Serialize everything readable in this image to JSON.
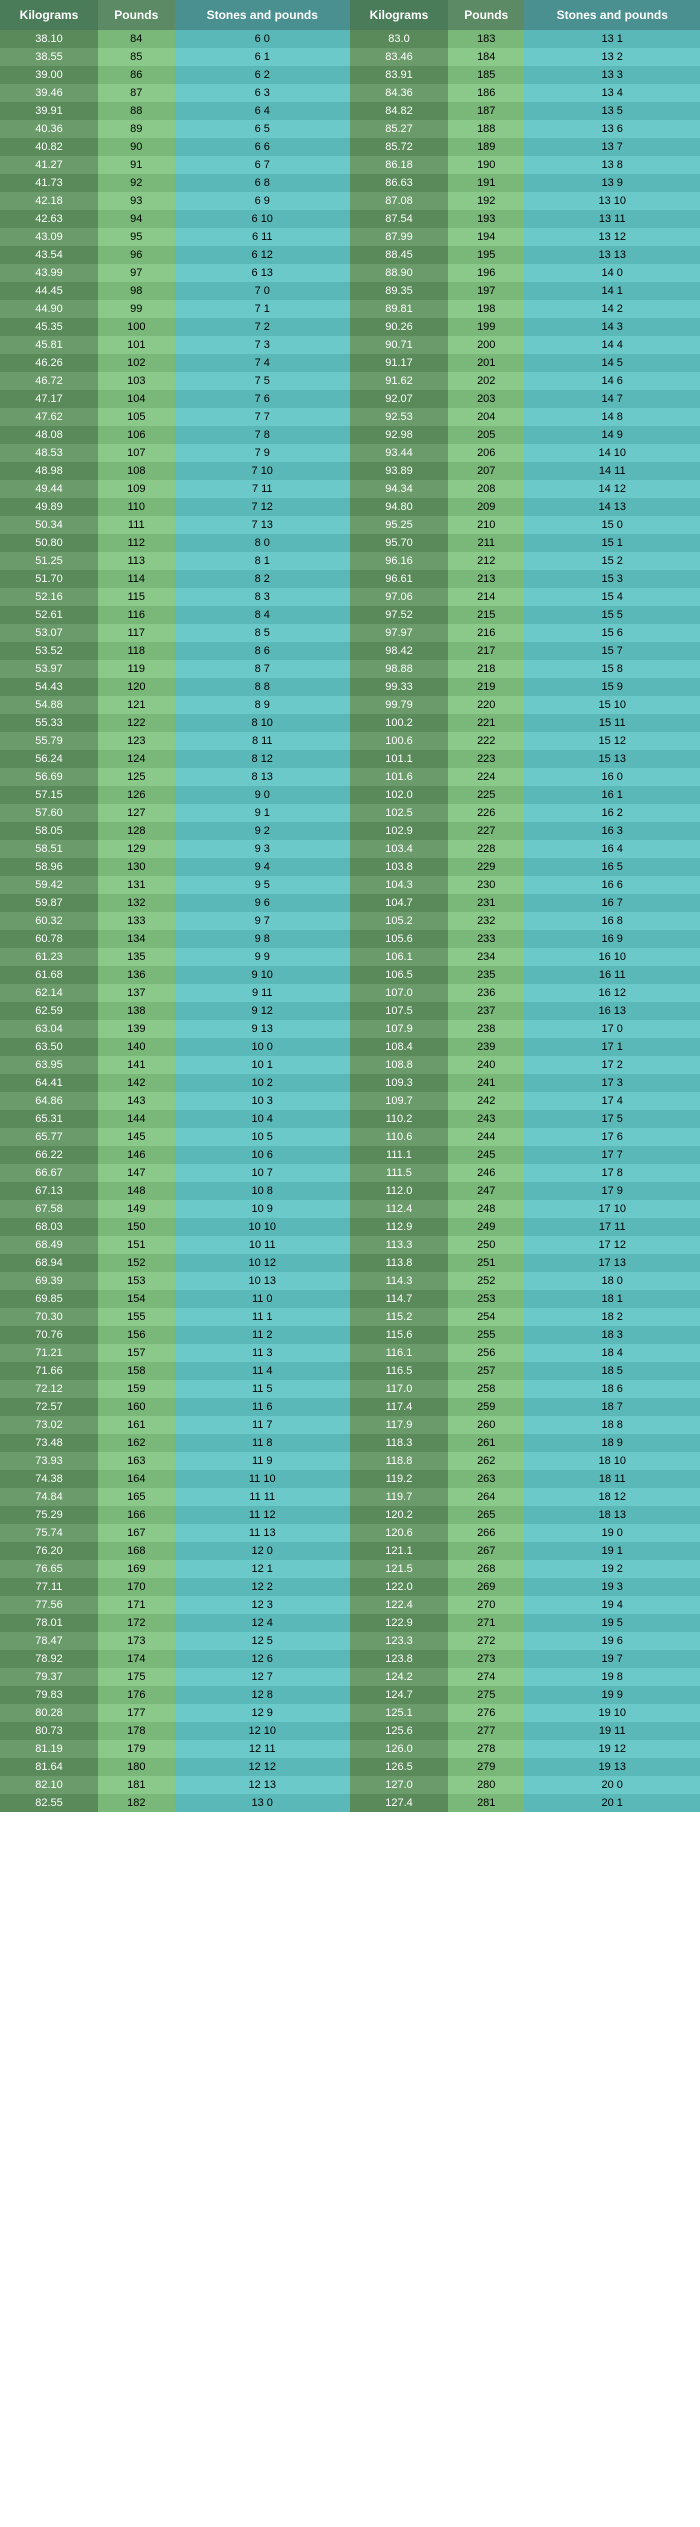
{
  "headers": {
    "col1": "Kilograms",
    "col2": "Pounds",
    "col3": "Stones and pounds",
    "col4": "Kilograms",
    "col5": "Pounds",
    "col6": "Stones and pounds"
  },
  "rows": [
    [
      "38.10",
      "84",
      "6",
      "0",
      "83.0",
      "183",
      "13",
      "1"
    ],
    [
      "38.55",
      "85",
      "6",
      "1",
      "83.46",
      "184",
      "13",
      "2"
    ],
    [
      "39.00",
      "86",
      "6",
      "2",
      "83.91",
      "185",
      "13",
      "3"
    ],
    [
      "39.46",
      "87",
      "6",
      "3",
      "84.36",
      "186",
      "13",
      "4"
    ],
    [
      "39.91",
      "88",
      "6",
      "4",
      "84.82",
      "187",
      "13",
      "5"
    ],
    [
      "40.36",
      "89",
      "6",
      "5",
      "85.27",
      "188",
      "13",
      "6"
    ],
    [
      "40.82",
      "90",
      "6",
      "6",
      "85.72",
      "189",
      "13",
      "7"
    ],
    [
      "41.27",
      "91",
      "6",
      "7",
      "86.18",
      "190",
      "13",
      "8"
    ],
    [
      "41.73",
      "92",
      "6",
      "8",
      "86.63",
      "191",
      "13",
      "9"
    ],
    [
      "42.18",
      "93",
      "6",
      "9",
      "87.08",
      "192",
      "13",
      "10"
    ],
    [
      "42.63",
      "94",
      "6",
      "10",
      "87.54",
      "193",
      "13",
      "11"
    ],
    [
      "43.09",
      "95",
      "6",
      "11",
      "87.99",
      "194",
      "13",
      "12"
    ],
    [
      "43.54",
      "96",
      "6",
      "12",
      "88.45",
      "195",
      "13",
      "13"
    ],
    [
      "43.99",
      "97",
      "6",
      "13",
      "88.90",
      "196",
      "14",
      "0"
    ],
    [
      "44.45",
      "98",
      "7",
      "0",
      "89.35",
      "197",
      "14",
      "1"
    ],
    [
      "44.90",
      "99",
      "7",
      "1",
      "89.81",
      "198",
      "14",
      "2"
    ],
    [
      "45.35",
      "100",
      "7",
      "2",
      "90.26",
      "199",
      "14",
      "3"
    ],
    [
      "45.81",
      "101",
      "7",
      "3",
      "90.71",
      "200",
      "14",
      "4"
    ],
    [
      "46.26",
      "102",
      "7",
      "4",
      "91.17",
      "201",
      "14",
      "5"
    ],
    [
      "46.72",
      "103",
      "7",
      "5",
      "91.62",
      "202",
      "14",
      "6"
    ],
    [
      "47.17",
      "104",
      "7",
      "6",
      "92.07",
      "203",
      "14",
      "7"
    ],
    [
      "47.62",
      "105",
      "7",
      "7",
      "92.53",
      "204",
      "14",
      "8"
    ],
    [
      "48.08",
      "106",
      "7",
      "8",
      "92.98",
      "205",
      "14",
      "9"
    ],
    [
      "48.53",
      "107",
      "7",
      "9",
      "93.44",
      "206",
      "14",
      "10"
    ],
    [
      "48.98",
      "108",
      "7",
      "10",
      "93.89",
      "207",
      "14",
      "11"
    ],
    [
      "49.44",
      "109",
      "7",
      "11",
      "94.34",
      "208",
      "14",
      "12"
    ],
    [
      "49.89",
      "110",
      "7",
      "12",
      "94.80",
      "209",
      "14",
      "13"
    ],
    [
      "50.34",
      "111",
      "7",
      "13",
      "95.25",
      "210",
      "15",
      "0"
    ],
    [
      "50.80",
      "112",
      "8",
      "0",
      "95.70",
      "211",
      "15",
      "1"
    ],
    [
      "51.25",
      "113",
      "8",
      "1",
      "96.16",
      "212",
      "15",
      "2"
    ],
    [
      "51.70",
      "114",
      "8",
      "2",
      "96.61",
      "213",
      "15",
      "3"
    ],
    [
      "52.16",
      "115",
      "8",
      "3",
      "97.06",
      "214",
      "15",
      "4"
    ],
    [
      "52.61",
      "116",
      "8",
      "4",
      "97.52",
      "215",
      "15",
      "5"
    ],
    [
      "53.07",
      "117",
      "8",
      "5",
      "97.97",
      "216",
      "15",
      "6"
    ],
    [
      "53.52",
      "118",
      "8",
      "6",
      "98.42",
      "217",
      "15",
      "7"
    ],
    [
      "53.97",
      "119",
      "8",
      "7",
      "98.88",
      "218",
      "15",
      "8"
    ],
    [
      "54.43",
      "120",
      "8",
      "8",
      "99.33",
      "219",
      "15",
      "9"
    ],
    [
      "54.88",
      "121",
      "8",
      "9",
      "99.79",
      "220",
      "15",
      "10"
    ],
    [
      "55.33",
      "122",
      "8",
      "10",
      "100.2",
      "221",
      "15",
      "11"
    ],
    [
      "55.79",
      "123",
      "8",
      "11",
      "100.6",
      "222",
      "15",
      "12"
    ],
    [
      "56.24",
      "124",
      "8",
      "12",
      "101.1",
      "223",
      "15",
      "13"
    ],
    [
      "56.69",
      "125",
      "8",
      "13",
      "101.6",
      "224",
      "16",
      "0"
    ],
    [
      "57.15",
      "126",
      "9",
      "0",
      "102.0",
      "225",
      "16",
      "1"
    ],
    [
      "57.60",
      "127",
      "9",
      "1",
      "102.5",
      "226",
      "16",
      "2"
    ],
    [
      "58.05",
      "128",
      "9",
      "2",
      "102.9",
      "227",
      "16",
      "3"
    ],
    [
      "58.51",
      "129",
      "9",
      "3",
      "103.4",
      "228",
      "16",
      "4"
    ],
    [
      "58.96",
      "130",
      "9",
      "4",
      "103.8",
      "229",
      "16",
      "5"
    ],
    [
      "59.42",
      "131",
      "9",
      "5",
      "104.3",
      "230",
      "16",
      "6"
    ],
    [
      "59.87",
      "132",
      "9",
      "6",
      "104.7",
      "231",
      "16",
      "7"
    ],
    [
      "60.32",
      "133",
      "9",
      "7",
      "105.2",
      "232",
      "16",
      "8"
    ],
    [
      "60.78",
      "134",
      "9",
      "8",
      "105.6",
      "233",
      "16",
      "9"
    ],
    [
      "61.23",
      "135",
      "9",
      "9",
      "106.1",
      "234",
      "16",
      "10"
    ],
    [
      "61.68",
      "136",
      "9",
      "10",
      "106.5",
      "235",
      "16",
      "11"
    ],
    [
      "62.14",
      "137",
      "9",
      "11",
      "107.0",
      "236",
      "16",
      "12"
    ],
    [
      "62.59",
      "138",
      "9",
      "12",
      "107.5",
      "237",
      "16",
      "13"
    ],
    [
      "63.04",
      "139",
      "9",
      "13",
      "107.9",
      "238",
      "17",
      "0"
    ],
    [
      "63.50",
      "140",
      "10",
      "0",
      "108.4",
      "239",
      "17",
      "1"
    ],
    [
      "63.95",
      "141",
      "10",
      "1",
      "108.8",
      "240",
      "17",
      "2"
    ],
    [
      "64.41",
      "142",
      "10",
      "2",
      "109.3",
      "241",
      "17",
      "3"
    ],
    [
      "64.86",
      "143",
      "10",
      "3",
      "109.7",
      "242",
      "17",
      "4"
    ],
    [
      "65.31",
      "144",
      "10",
      "4",
      "110.2",
      "243",
      "17",
      "5"
    ],
    [
      "65.77",
      "145",
      "10",
      "5",
      "110.6",
      "244",
      "17",
      "6"
    ],
    [
      "66.22",
      "146",
      "10",
      "6",
      "111.1",
      "245",
      "17",
      "7"
    ],
    [
      "66.67",
      "147",
      "10",
      "7",
      "111.5",
      "246",
      "17",
      "8"
    ],
    [
      "67.13",
      "148",
      "10",
      "8",
      "112.0",
      "247",
      "17",
      "9"
    ],
    [
      "67.58",
      "149",
      "10",
      "9",
      "112.4",
      "248",
      "17",
      "10"
    ],
    [
      "68.03",
      "150",
      "10",
      "10",
      "112.9",
      "249",
      "17",
      "11"
    ],
    [
      "68.49",
      "151",
      "10",
      "11",
      "113.3",
      "250",
      "17",
      "12"
    ],
    [
      "68.94",
      "152",
      "10",
      "12",
      "113.8",
      "251",
      "17",
      "13"
    ],
    [
      "69.39",
      "153",
      "10",
      "13",
      "114.3",
      "252",
      "18",
      "0"
    ],
    [
      "69.85",
      "154",
      "11",
      "0",
      "114.7",
      "253",
      "18",
      "1"
    ],
    [
      "70.30",
      "155",
      "11",
      "1",
      "115.2",
      "254",
      "18",
      "2"
    ],
    [
      "70.76",
      "156",
      "11",
      "2",
      "115.6",
      "255",
      "18",
      "3"
    ],
    [
      "71.21",
      "157",
      "11",
      "3",
      "116.1",
      "256",
      "18",
      "4"
    ],
    [
      "71.66",
      "158",
      "11",
      "4",
      "116.5",
      "257",
      "18",
      "5"
    ],
    [
      "72.12",
      "159",
      "11",
      "5",
      "117.0",
      "258",
      "18",
      "6"
    ],
    [
      "72.57",
      "160",
      "11",
      "6",
      "117.4",
      "259",
      "18",
      "7"
    ],
    [
      "73.02",
      "161",
      "11",
      "7",
      "117.9",
      "260",
      "18",
      "8"
    ],
    [
      "73.48",
      "162",
      "11",
      "8",
      "118.3",
      "261",
      "18",
      "9"
    ],
    [
      "73.93",
      "163",
      "11",
      "9",
      "118.8",
      "262",
      "18",
      "10"
    ],
    [
      "74.38",
      "164",
      "11",
      "10",
      "119.2",
      "263",
      "18",
      "11"
    ],
    [
      "74.84",
      "165",
      "11",
      "11",
      "119.7",
      "264",
      "18",
      "12"
    ],
    [
      "75.29",
      "166",
      "11",
      "12",
      "120.2",
      "265",
      "18",
      "13"
    ],
    [
      "75.74",
      "167",
      "11",
      "13",
      "120.6",
      "266",
      "19",
      "0"
    ],
    [
      "76.20",
      "168",
      "12",
      "0",
      "121.1",
      "267",
      "19",
      "1"
    ],
    [
      "76.65",
      "169",
      "12",
      "1",
      "121.5",
      "268",
      "19",
      "2"
    ],
    [
      "77.11",
      "170",
      "12",
      "2",
      "122.0",
      "269",
      "19",
      "3"
    ],
    [
      "77.56",
      "171",
      "12",
      "3",
      "122.4",
      "270",
      "19",
      "4"
    ],
    [
      "78.01",
      "172",
      "12",
      "4",
      "122.9",
      "271",
      "19",
      "5"
    ],
    [
      "78.47",
      "173",
      "12",
      "5",
      "123.3",
      "272",
      "19",
      "6"
    ],
    [
      "78.92",
      "174",
      "12",
      "6",
      "123.8",
      "273",
      "19",
      "7"
    ],
    [
      "79.37",
      "175",
      "12",
      "7",
      "124.2",
      "274",
      "19",
      "8"
    ],
    [
      "79.83",
      "176",
      "12",
      "8",
      "124.7",
      "275",
      "19",
      "9"
    ],
    [
      "80.28",
      "177",
      "12",
      "9",
      "125.1",
      "276",
      "19",
      "10"
    ],
    [
      "80.73",
      "178",
      "12",
      "10",
      "125.6",
      "277",
      "19",
      "11"
    ],
    [
      "81.19",
      "179",
      "12",
      "11",
      "126.0",
      "278",
      "19",
      "12"
    ],
    [
      "81.64",
      "180",
      "12",
      "12",
      "126.5",
      "279",
      "19",
      "13"
    ],
    [
      "82.10",
      "181",
      "12",
      "13",
      "127.0",
      "280",
      "20",
      "0"
    ],
    [
      "82.55",
      "182",
      "13",
      "0",
      "127.4",
      "281",
      "20",
      "1"
    ]
  ]
}
